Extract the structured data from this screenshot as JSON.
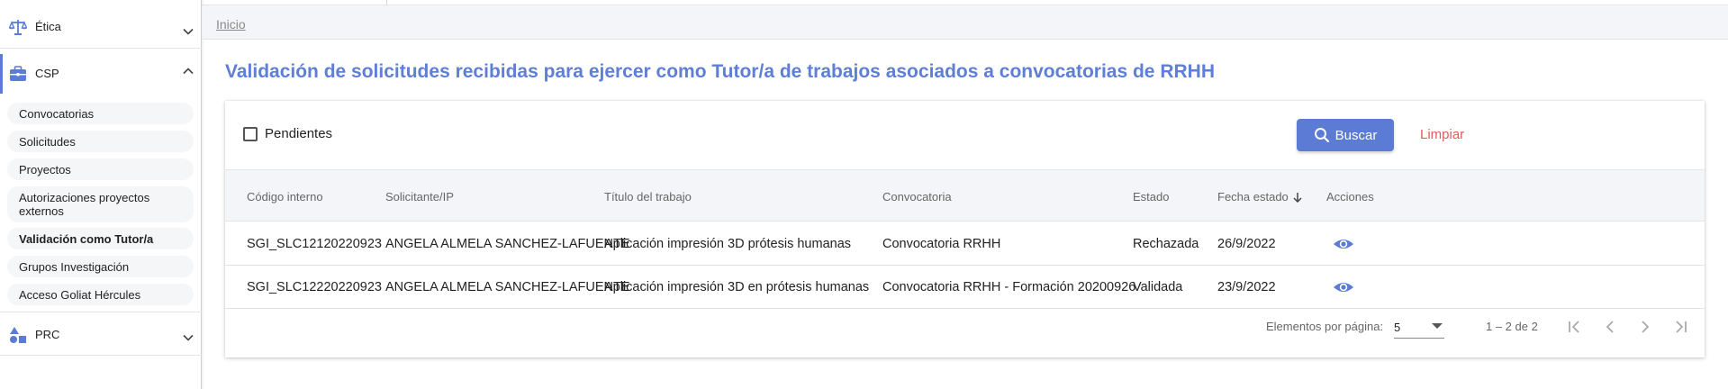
{
  "sidebar": {
    "groups": [
      {
        "label": "Ética",
        "icon": "scales-icon",
        "expanded": false
      },
      {
        "label": "CSP",
        "icon": "briefcase-icon",
        "expanded": true
      },
      {
        "label": "PRC",
        "icon": "shapes-icon",
        "expanded": false
      }
    ],
    "csp_items": [
      "Convocatorias",
      "Solicitudes",
      "Proyectos",
      "Autorizaciones proyectos externos",
      "Validación como Tutor/a",
      "Grupos Investigación",
      "Acceso Goliat Hércules"
    ],
    "selected_item": "Validación como Tutor/a"
  },
  "breadcrumb": {
    "home": "Inicio"
  },
  "page": {
    "title": "Validación de solicitudes recibidas para ejercer como Tutor/a de trabajos asociados a convocatorias de RRHH"
  },
  "filters": {
    "pending_label": "Pendientes",
    "pending_checked": false,
    "search_label": "Buscar",
    "clear_label": "Limpiar"
  },
  "table": {
    "columns": [
      "Código interno",
      "Solicitante/IP",
      "Título del trabajo",
      "Convocatoria",
      "Estado",
      "Fecha estado",
      "Acciones"
    ],
    "sorted_column": "Fecha estado",
    "sort_direction": "descending",
    "rows": [
      {
        "codigo": "SGI_SLC12120220923",
        "solicitante": "ANGELA ALMELA SANCHEZ-LAFUENTE",
        "titulo": "Aplicación impresión 3D prótesis humanas",
        "convocatoria": "Convocatoria RRHH",
        "estado": "Rechazada",
        "fecha": "26/9/2022"
      },
      {
        "codigo": "SGI_SLC12220220923",
        "solicitante": "ANGELA ALMELA SANCHEZ-LAFUENTE",
        "titulo": "Aplicación impresión 3D en prótesis humanas",
        "convocatoria": "Convocatoria RRHH - Formación 20200926",
        "estado": "Validada",
        "fecha": "23/9/2022"
      }
    ]
  },
  "paginator": {
    "items_per_page_label": "Elementos por página:",
    "page_size": "5",
    "range_label": "1 – 2 de 2"
  },
  "colors": {
    "accent": "#5b7bd5",
    "title": "#5f7fd6",
    "clear": "#e35b5b",
    "header_bg": "#f3f5f8"
  }
}
